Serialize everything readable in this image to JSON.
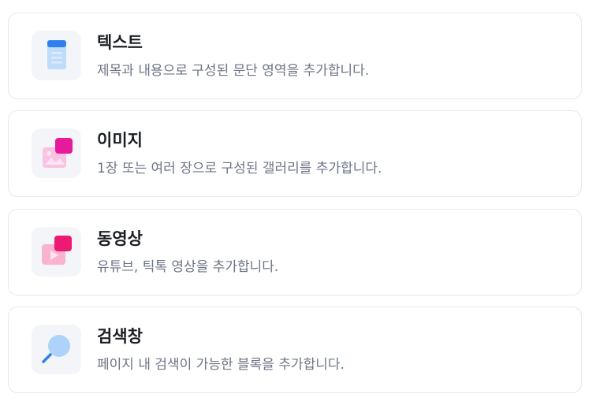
{
  "blocks": [
    {
      "title": "텍스트",
      "description": "제목과 내용으로 구성된 문단 영역을 추가합니다.",
      "icon": "text-document-icon"
    },
    {
      "title": "이미지",
      "description": "1장 또는 여러 장으로 구성된 갤러리를 추가합니다.",
      "icon": "image-gallery-icon"
    },
    {
      "title": "동영상",
      "description": "유튜브, 틱톡 영상을 추가합니다.",
      "icon": "video-play-icon"
    },
    {
      "title": "검색창",
      "description": "페이지 내 검색이 가능한 블록을 추가합니다.",
      "icon": "search-magnifier-icon"
    }
  ],
  "colors": {
    "title_text": "#1b1e24",
    "description_text": "#6b7585",
    "card_border": "#e6e8ec",
    "icon_tile_bg": "#f3f5f8",
    "text_icon_blue": "#3b82f6",
    "media_icon_pink": "#ec4899"
  }
}
